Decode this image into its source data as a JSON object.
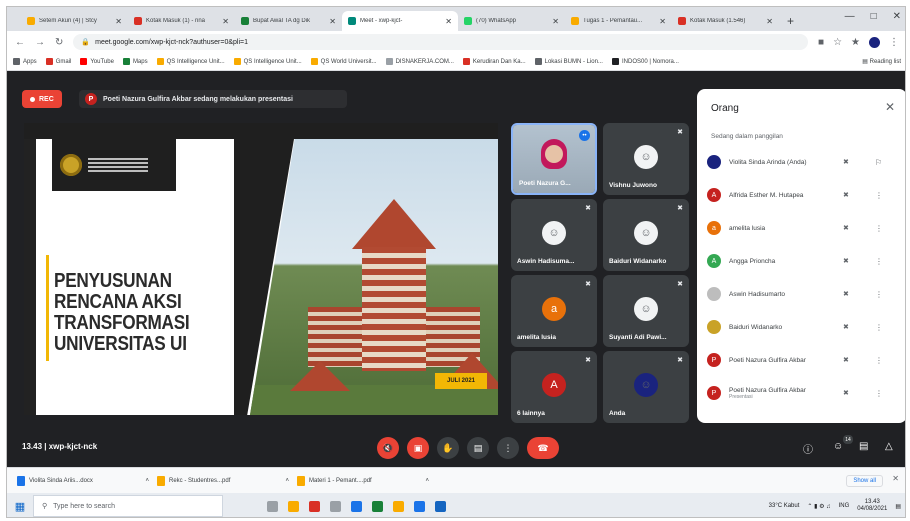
{
  "browser": {
    "tabs": [
      {
        "title": "Setem Akun (4) | Stcy",
        "color": "#f9ab00"
      },
      {
        "title": "Kotak Masuk (1) - rina",
        "color": "#d93025"
      },
      {
        "title": "Bupat Awal TA dg Dik",
        "color": "#188038"
      },
      {
        "title": "Meet - xwp-kjct-",
        "color": "#00897b"
      },
      {
        "title": "(70) WhatsApp",
        "color": "#25d366"
      },
      {
        "title": "Tugas 1 - Pemantau...",
        "color": "#f9ab00"
      },
      {
        "title": "Kotak Masuk (1.546)",
        "color": "#d93025"
      }
    ],
    "active_tab_index": 3,
    "new_tab": "+",
    "window_controls": [
      "—",
      "□",
      "✕"
    ],
    "url": "meet.google.com/xwp-kjct-nck?authuser=0&pli=1",
    "bookmarks": [
      {
        "label": "Apps",
        "color": "#5f6368"
      },
      {
        "label": "Gmail",
        "color": "#d93025"
      },
      {
        "label": "YouTube",
        "color": "#ff0000"
      },
      {
        "label": "Maps",
        "color": "#188038"
      },
      {
        "label": "QS Intelligence Unit...",
        "color": "#f9ab00"
      },
      {
        "label": "QS Intelligence Unit...",
        "color": "#f9ab00"
      },
      {
        "label": "QS World Universit...",
        "color": "#f9ab00"
      },
      {
        "label": "DISNAKERJA.COM...",
        "color": "#9aa0a6"
      },
      {
        "label": "Kerudiran Dan Ka...",
        "color": "#d93025"
      },
      {
        "label": "Lokasi BUMN - Lion...",
        "color": "#5f6368"
      },
      {
        "label": "INDOS00 | Nomora...",
        "color": "#202124"
      }
    ],
    "reading_list": "Reading list"
  },
  "meet": {
    "rec_label": "REC",
    "presenter_initial": "P",
    "presenter_notice": "Poeti Nazura Gulfira Akbar sedang melakukan presentasi",
    "slide": {
      "title": "PENYUSUNAN RENCANA AKSI TRANSFORMASI UNIVERSITAS UI",
      "date": "JULI 2021"
    },
    "tiles": [
      {
        "name": "Poeti Nazura G...",
        "type": "video",
        "color": "#1a73e8",
        "initial": ""
      },
      {
        "name": "Vishnu Juwono",
        "type": "photo",
        "color": "#f1f3f4",
        "initial": ""
      },
      {
        "name": "Aswin Hadisuma...",
        "type": "photo",
        "color": "#f1f3f4",
        "initial": ""
      },
      {
        "name": "Baiduri Widanarko",
        "type": "photo",
        "color": "#f1f3f4",
        "initial": ""
      },
      {
        "name": "amelita lusia",
        "type": "initial",
        "color": "#e8710a",
        "initial": "a"
      },
      {
        "name": "Suyanti Adi Pawi...",
        "type": "photo",
        "color": "#f1f3f4",
        "initial": ""
      },
      {
        "name": "6 lainnya",
        "type": "initial",
        "color": "#c5221f",
        "initial": "A"
      },
      {
        "name": "Anda",
        "type": "photo",
        "color": "#1a237e",
        "initial": ""
      }
    ],
    "meeting_label": "13.43  |  xwp-kjct-nck",
    "participant_count": "14"
  },
  "people": {
    "title": "Orang",
    "section": "Sedang dalam panggilan",
    "rows": [
      {
        "name": "Violita Sinda Arinda (Anda)",
        "sub": "",
        "initial": "",
        "color": "#1a237e"
      },
      {
        "name": "Alfrida Esther M. Hutapea",
        "sub": "",
        "initial": "A",
        "color": "#c5221f"
      },
      {
        "name": "amelita lusia",
        "sub": "",
        "initial": "a",
        "color": "#e8710a"
      },
      {
        "name": "Angga Prioncha",
        "sub": "",
        "initial": "A",
        "color": "#34a853"
      },
      {
        "name": "Aswin Hadisumarto",
        "sub": "",
        "initial": "",
        "color": "#bdbdbd"
      },
      {
        "name": "Baiduri Widanarko",
        "sub": "",
        "initial": "",
        "color": "#c9a227"
      },
      {
        "name": "Poeti Nazura Gulfira Akbar",
        "sub": "",
        "initial": "P",
        "color": "#c5221f"
      },
      {
        "name": "Poeti Nazura Gulfira Akbar",
        "sub": "Presentasi",
        "initial": "P",
        "color": "#c5221f"
      }
    ]
  },
  "downloads": {
    "items": [
      {
        "name": "Violita Sinda Ariis...docx",
        "color": "#1a73e8"
      },
      {
        "name": "Rekc - Studentres...pdf",
        "color": "#f9ab00"
      },
      {
        "name": "Materi 1 - Pemant....pdf",
        "color": "#f9ab00"
      }
    ],
    "show_all": "Show all"
  },
  "taskbar": {
    "search_placeholder": "Type here to search",
    "weather": "33°C Kabut",
    "lang": "ING",
    "time": "13.43",
    "date": "04/08/2021"
  }
}
